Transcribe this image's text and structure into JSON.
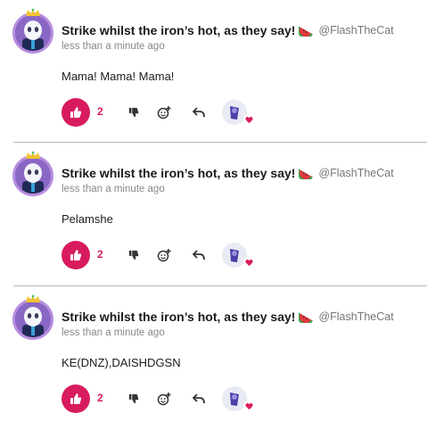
{
  "comments": [
    {
      "author_name": "Strike whilst the iron’s hot, as they say!",
      "badge_icon": "watermelon-icon",
      "handle": "@FlashTheCat",
      "timestamp": "less than a minute ago",
      "text": "Mama! Mama! Mama!",
      "likes": "2"
    },
    {
      "author_name": "Strike whilst the iron’s hot, as they say!",
      "badge_icon": "watermelon-icon",
      "handle": "@FlashTheCat",
      "timestamp": "less than a minute ago",
      "text": "Pelamshe",
      "likes": "2"
    },
    {
      "author_name": "Strike whilst the iron’s hot, as they say!",
      "badge_icon": "watermelon-icon",
      "handle": "@FlashTheCat",
      "timestamp": "less than a minute ago",
      "text": "KE(DNZ),DAISHDGSN",
      "likes": "2"
    }
  ],
  "colors": {
    "like_accent": "#d81b5e",
    "avatar_ring": "#b88de0",
    "divider": "#b8b8b8"
  },
  "icons": [
    "thumbs-up-icon",
    "thumbs-down-icon",
    "add-reaction-icon",
    "reply-icon",
    "heart-icon"
  ]
}
